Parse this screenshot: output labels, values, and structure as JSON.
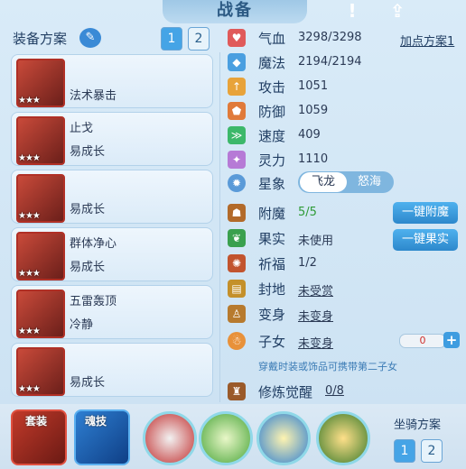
{
  "title": "战备",
  "header": {
    "plan_label": "装备方案",
    "tabs": [
      "1",
      "2"
    ]
  },
  "top_icons": [
    "alert-icon",
    "share-icon"
  ],
  "equipment": [
    {
      "line1": "",
      "line2": "法术暴击",
      "stars": "★★★"
    },
    {
      "line1": "止戈",
      "line2": "易成长",
      "stars": "★★★"
    },
    {
      "line1": "",
      "line2": "易成长",
      "stars": "★★★"
    },
    {
      "line1": "群体净心",
      "line2": "易成长",
      "stars": "★★★"
    },
    {
      "line1": "五雷轰顶",
      "line2": "冷静",
      "stars": "★★★"
    },
    {
      "line1": "",
      "line2": "易成长",
      "stars": "★★★"
    }
  ],
  "stats": [
    {
      "label": "气血",
      "value": "3298/3298",
      "color": "#e05a5a"
    },
    {
      "label": "魔法",
      "value": "2194/2194",
      "color": "#4a9fe0"
    },
    {
      "label": "攻击",
      "value": "1051",
      "color": "#e8a33a"
    },
    {
      "label": "防御",
      "value": "1059",
      "color": "#e07a3a"
    },
    {
      "label": "速度",
      "value": "409",
      "color": "#3cb86a"
    },
    {
      "label": "灵力",
      "value": "1110",
      "color": "#b67ad6"
    }
  ],
  "points_plan": "加点方案1",
  "star_sign": {
    "label": "星象",
    "options": [
      "飞龙",
      "怒海"
    ],
    "selected": 0
  },
  "rows": [
    {
      "label": "附魔",
      "value": "5/5",
      "value_color": "#2e9b36"
    },
    {
      "label": "果实",
      "value": "未使用",
      "value_color": "#2b3a55"
    },
    {
      "label": "祈福",
      "value": "1/2",
      "value_color": "#2b3a55"
    },
    {
      "label": "封地",
      "value": "未受赏",
      "value_color": "#2b3a55"
    },
    {
      "label": "变身",
      "value": "未变身",
      "value_color": "#2b3a55"
    },
    {
      "label": "子女",
      "value": "未变身",
      "value_color": "#2b3a55"
    }
  ],
  "buttons": {
    "enchant": "一键附魔",
    "fruit": "一键果实"
  },
  "child_progress": "0",
  "child_note": "穿戴时装或饰品可携带第二子女",
  "awaken": {
    "label": "修炼觉醒",
    "value": "0/8"
  },
  "bottom": {
    "suit": "套装",
    "soul": "魂技",
    "mount_label": "坐骑方案",
    "mount_tabs": [
      "1",
      "2"
    ]
  }
}
